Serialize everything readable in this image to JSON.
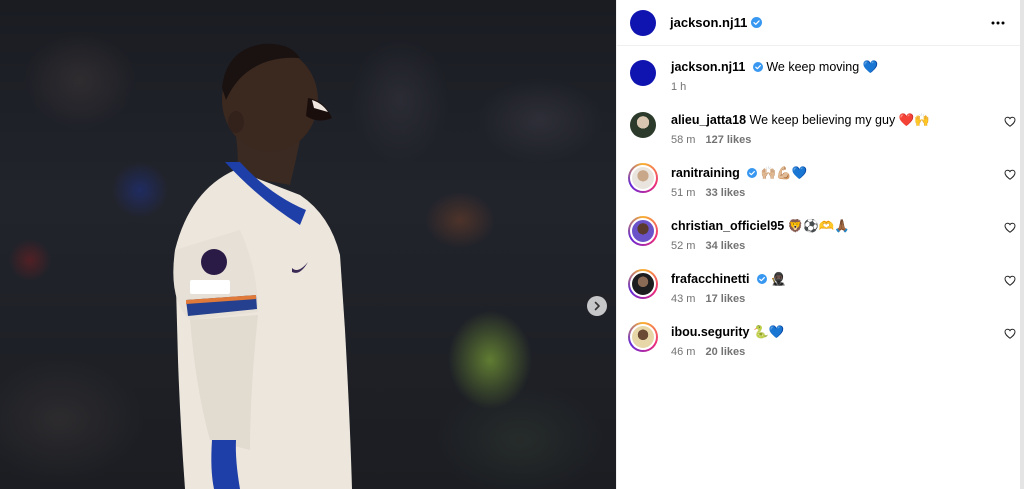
{
  "post": {
    "author": "jackson.nj11",
    "author_verified": true,
    "caption_text": "We keep moving 💙",
    "caption_time": "1 h"
  },
  "icons": {
    "verified": "verified-badge-icon",
    "more": "more-options-icon",
    "like": "heart-outline-icon",
    "next": "chevron-right-icon"
  },
  "colors": {
    "verified_blue": "#3897f0",
    "avatar_blue": "#0f13b0",
    "meta_gray": "#737373"
  },
  "comments": [
    {
      "user": "alieu_jatta18",
      "verified": false,
      "text": "We keep believing my guy ❤️🙌",
      "time": "58 m",
      "likes": "127 likes"
    },
    {
      "user": "ranitraining",
      "verified": true,
      "text": "🙌🏼💪🏼💙",
      "time": "51 m",
      "likes": "33 likes"
    },
    {
      "user": "christian_officiel95",
      "verified": false,
      "text": "🦁⚽️🫶🙏🏾",
      "time": "52 m",
      "likes": "34 likes"
    },
    {
      "user": "frafacchinetti",
      "verified": true,
      "text": "🥷🏿",
      "time": "43 m",
      "likes": "17 likes"
    },
    {
      "user": "ibou.segurity",
      "verified": false,
      "text": "🐍💙",
      "time": "46 m",
      "likes": "20 likes"
    }
  ]
}
